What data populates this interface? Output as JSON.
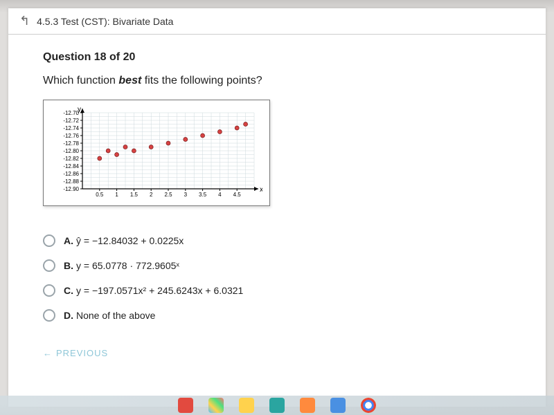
{
  "breadcrumb": {
    "text": "4.5.3 Test (CST): Bivariate Data"
  },
  "question": {
    "header": "Question 18 of 20",
    "prompt_before": "Which function ",
    "prompt_em": "best",
    "prompt_after": " fits the following points?"
  },
  "chart_data": {
    "type": "scatter",
    "title": "",
    "xlabel": "x",
    "ylabel": "y",
    "xlim": [
      0,
      5
    ],
    "ylim": [
      -12.9,
      -12.7
    ],
    "x_ticks": [
      0.5,
      1,
      1.5,
      2,
      2.5,
      3,
      3.5,
      4,
      4.5
    ],
    "y_ticks": [
      -12.7,
      -12.72,
      -12.74,
      -12.76,
      -12.78,
      -12.8,
      -12.82,
      -12.84,
      -12.86,
      -12.88,
      -12.9
    ],
    "y_tick_labels": [
      "-12.70",
      "-12.72",
      "-12.74",
      "-12.76",
      "-12.78",
      "-12.80",
      "-12.82",
      "-12.84",
      "-12.86",
      "-12.88",
      "-12.90"
    ],
    "x": [
      0.5,
      0.75,
      1.0,
      1.25,
      1.5,
      2.0,
      2.5,
      3.0,
      3.5,
      4.0,
      4.5,
      4.75
    ],
    "y": [
      -12.82,
      -12.8,
      -12.81,
      -12.79,
      -12.8,
      -12.79,
      -12.78,
      -12.77,
      -12.76,
      -12.75,
      -12.74,
      -12.73
    ]
  },
  "options": {
    "A": {
      "letter": "A.",
      "text": "ŷ = −12.84032 + 0.0225x"
    },
    "B": {
      "letter": "B.",
      "text": "y = 65.0778 · 772.9605ˣ"
    },
    "C": {
      "letter": "C.",
      "text": "y = −197.0571x² + 245.6243x + 6.0321"
    },
    "D": {
      "letter": "D.",
      "text": "None of the above"
    }
  },
  "nav": {
    "previous": "PREVIOUS"
  }
}
